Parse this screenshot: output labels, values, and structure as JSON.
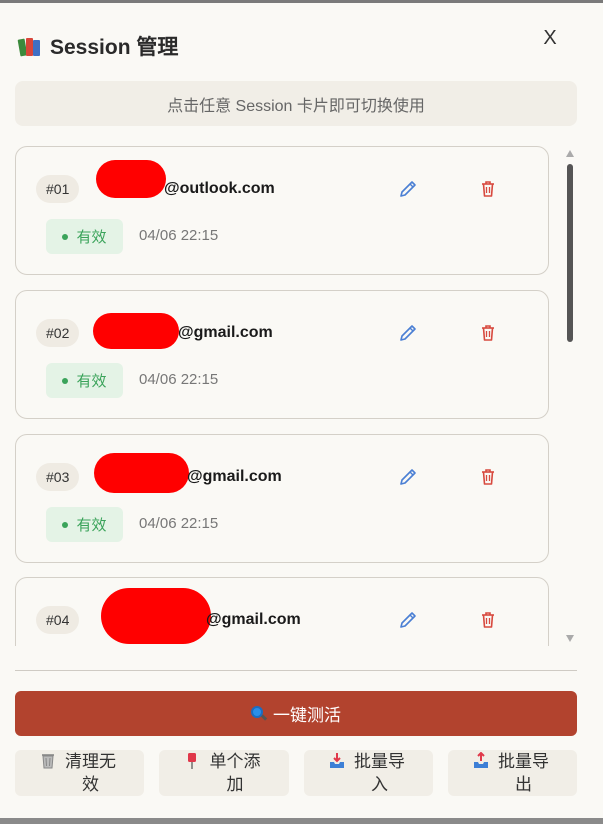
{
  "header": {
    "title": "Session 管理",
    "close_label": "X"
  },
  "hint": "点击任意 Session 卡片即可切换使用",
  "sessions": [
    {
      "num": "#01",
      "email": "@outlook.com",
      "status": "有效",
      "time": "04/06 22:15"
    },
    {
      "num": "#02",
      "email": "@gmail.com",
      "status": "有效",
      "time": "04/06 22:15"
    },
    {
      "num": "#03",
      "email": "@gmail.com",
      "status": "有效",
      "time": "04/06 22:15"
    },
    {
      "num": "#04",
      "email": "@gmail.com",
      "status": "",
      "time": ""
    }
  ],
  "actions": {
    "activate_all": "一键测活",
    "clean_invalid": "清理无效",
    "add_single": "单个添加",
    "batch_import": "批量导入",
    "batch_export": "批量导出"
  },
  "icons": {
    "header": "books-icon",
    "close": "close-icon",
    "edit": "pencil-icon",
    "delete": "trash-icon",
    "activate": "magnifier-icon",
    "clean": "wastebasket-icon",
    "add": "pushpin-icon",
    "import": "inbox-tray-icon",
    "export": "outbox-tray-icon"
  },
  "colors": {
    "accent": "#b2432e",
    "valid_green": "#3aa35a",
    "edit_blue": "#4a7fd4",
    "delete_red": "#d84a3f"
  }
}
